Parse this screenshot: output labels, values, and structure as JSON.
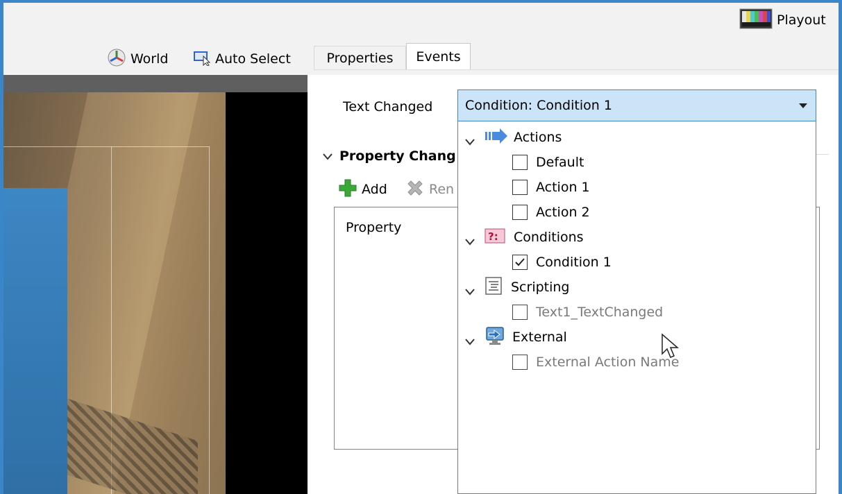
{
  "header": {
    "playout_label": "Playout",
    "world_label": "World",
    "auto_select_label": "Auto Select"
  },
  "tabs": [
    {
      "label": "Properties",
      "active": false
    },
    {
      "label": "Events",
      "active": true
    }
  ],
  "event": {
    "name_label": "Text Changed",
    "selected_value": "Condition: Condition 1"
  },
  "property_changes": {
    "section_label": "Property Chang",
    "add_label": "Add",
    "remove_label": "Ren",
    "column_header": "Property"
  },
  "dropdown": {
    "groups": [
      {
        "label": "Actions",
        "icon": "arrow-right-icon",
        "items": [
          {
            "label": "Default",
            "checked": false,
            "enabled": true
          },
          {
            "label": "Action 1",
            "checked": false,
            "enabled": true
          },
          {
            "label": "Action 2",
            "checked": false,
            "enabled": true
          }
        ]
      },
      {
        "label": "Conditions",
        "icon": "question-icon",
        "items": [
          {
            "label": "Condition 1",
            "checked": true,
            "enabled": true
          }
        ]
      },
      {
        "label": "Scripting",
        "icon": "script-icon",
        "items": [
          {
            "label": "Text1_TextChanged",
            "checked": false,
            "enabled": false
          }
        ]
      },
      {
        "label": "External",
        "icon": "monitor-arrow-icon",
        "items": [
          {
            "label": "External Action Name",
            "checked": false,
            "enabled": false
          }
        ]
      }
    ]
  },
  "colors": {
    "accent": "#3b86c9",
    "combo_bg": "#cce4f7",
    "add_green": "#3aa935",
    "remove_gray": "#9a9a9a"
  }
}
